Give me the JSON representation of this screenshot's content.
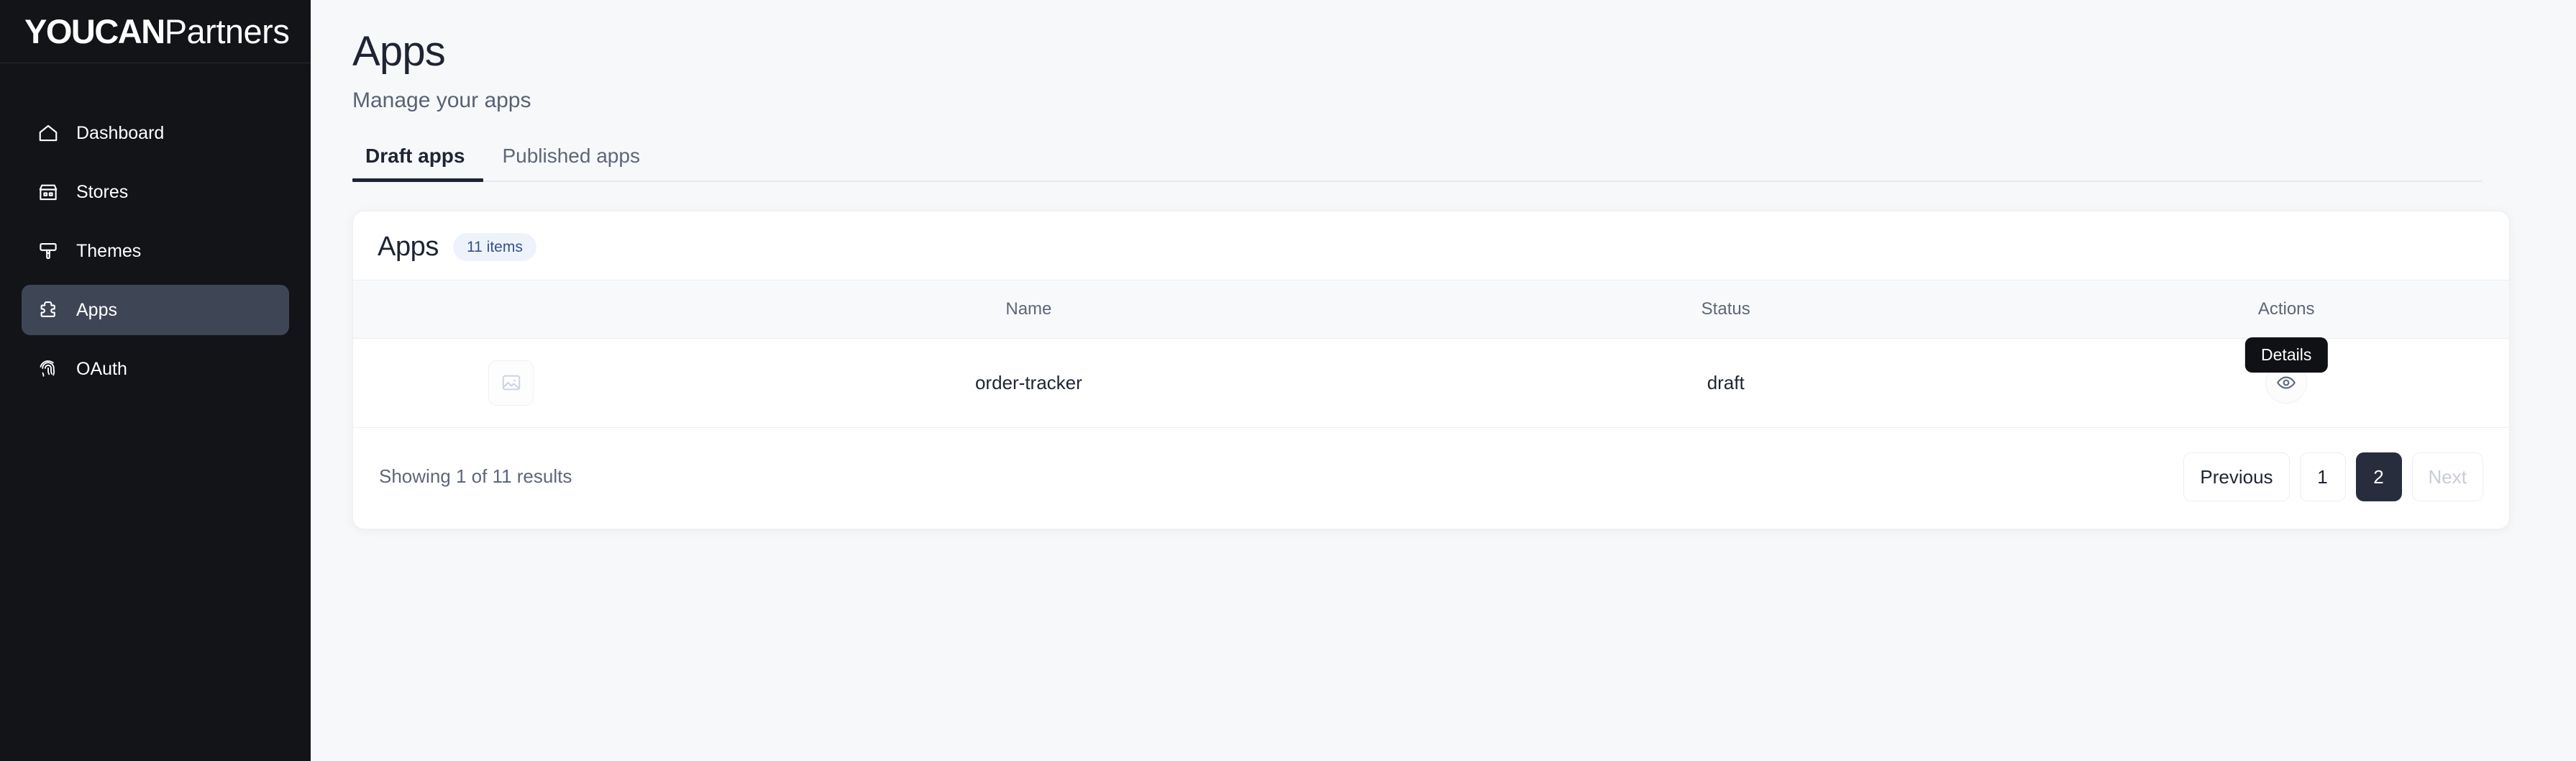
{
  "brand": {
    "primary": "YOUCAN",
    "secondary": "Partners"
  },
  "sidebar": {
    "items": [
      {
        "label": "Dashboard",
        "icon": "home-icon",
        "active": false
      },
      {
        "label": "Stores",
        "icon": "store-icon",
        "active": false
      },
      {
        "label": "Themes",
        "icon": "paintbrush-icon",
        "active": false
      },
      {
        "label": "Apps",
        "icon": "puzzle-icon",
        "active": true
      },
      {
        "label": "OAuth",
        "icon": "fingerprint-icon",
        "active": false
      }
    ],
    "active_background": "#3e4656",
    "background": "#121417"
  },
  "header": {
    "title": "Apps",
    "subtitle": "Manage your apps"
  },
  "tabs": [
    {
      "label": "Draft apps",
      "active": true
    },
    {
      "label": "Published apps",
      "active": false
    }
  ],
  "card": {
    "title": "Apps",
    "count_badge": "11 items",
    "badge_color": "#eef3fb",
    "badge_text_color": "#35508c",
    "columns": {
      "thumb": "",
      "name": "Name",
      "status": "Status",
      "actions": "Actions"
    },
    "rows": [
      {
        "thumb_icon": "image-placeholder-icon",
        "name": "order-tracker",
        "status": "draft",
        "action_icon": "eye-icon",
        "action_tooltip": "Details"
      }
    ],
    "footer": {
      "results_text": "Showing 1 of 11 results",
      "pagination": {
        "previous_label": "Previous",
        "next_label": "Next",
        "next_disabled": true,
        "pages": [
          {
            "label": "1",
            "active": false
          },
          {
            "label": "2",
            "active": true
          }
        ]
      }
    }
  }
}
